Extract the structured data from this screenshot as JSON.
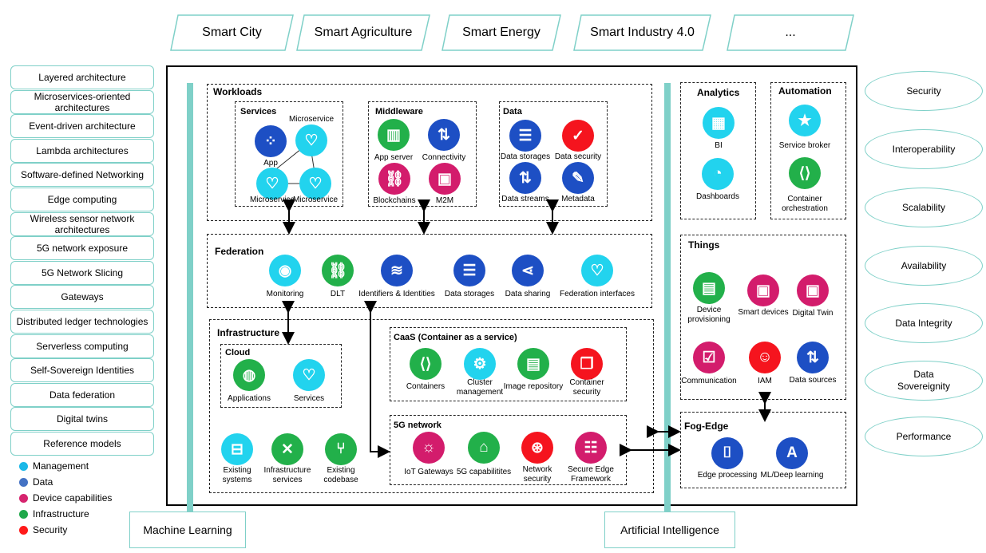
{
  "domains": [
    "Smart City",
    "Smart Agriculture",
    "Smart Energy",
    "Smart Industry 4.0",
    "..."
  ],
  "left_concepts": [
    "Layered architecture",
    "Microservices-oriented architectures",
    "Event-driven architecture",
    "Lambda architectures",
    "Software-defined Networking",
    "Edge computing",
    "Wireless sensor network architectures",
    "5G network exposure",
    "5G Network Slicing",
    "Gateways",
    "Distributed ledger technologies",
    "Serverless computing",
    "Self-Sovereign Identities",
    "Data federation",
    "Digital twins",
    "Reference models"
  ],
  "legend": [
    {
      "label": "Management",
      "color": "#1ab8e8"
    },
    {
      "label": "Data",
      "color": "#4472c4"
    },
    {
      "label": "Device capabilities",
      "color": "#d6246e"
    },
    {
      "label": "Infrastructure",
      "color": "#1fa84a"
    },
    {
      "label": "Security",
      "color": "#ff1a1a"
    }
  ],
  "colors": {
    "management": "#22d3ee",
    "data": "#1d4fc4",
    "device": "#d31c6c",
    "infrastructure": "#22b04a",
    "security": "#f5141e",
    "teal": "#7fd0c8"
  },
  "workloads": {
    "title": "Workloads",
    "services": {
      "title": "Services",
      "items": [
        {
          "label": "App",
          "icon": "apps-grid-icon",
          "category": "data"
        },
        {
          "label": "Microservice",
          "icon": "heart-link-icon",
          "category": "management"
        },
        {
          "label": "Microservice",
          "icon": "heart-link-icon",
          "category": "management"
        },
        {
          "label": "Microservice",
          "icon": "heart-link-icon",
          "category": "management"
        }
      ]
    },
    "middleware": {
      "title": "Middleware",
      "items": [
        {
          "label": "App server",
          "icon": "server-icon",
          "category": "infrastructure"
        },
        {
          "label": "Connectivity",
          "icon": "up-down-arrows-icon",
          "category": "data"
        },
        {
          "label": "Blockchains",
          "icon": "chain-link-icon",
          "category": "device"
        },
        {
          "label": "M2M",
          "icon": "chip-icon",
          "category": "device"
        }
      ]
    },
    "data": {
      "title": "Data",
      "items": [
        {
          "label": "Data storages",
          "icon": "database-icon",
          "category": "data"
        },
        {
          "label": "Data security",
          "icon": "shield-check-icon",
          "category": "security"
        },
        {
          "label": "Data streams",
          "icon": "up-down-arrows-icon",
          "category": "data"
        },
        {
          "label": "Metadata",
          "icon": "edit-document-icon",
          "category": "data"
        }
      ]
    }
  },
  "federation": {
    "title": "Federation",
    "items": [
      {
        "label": "Monitoring",
        "icon": "eye-icon",
        "category": "management"
      },
      {
        "label": "DLT",
        "icon": "chain-link-icon",
        "category": "infrastructure"
      },
      {
        "label": "Identifiers & Identities",
        "icon": "layers-icon",
        "category": "data"
      },
      {
        "label": "Data storages",
        "icon": "database-icon",
        "category": "data"
      },
      {
        "label": "Data sharing",
        "icon": "share-icon",
        "category": "data"
      },
      {
        "label": "Federation interfaces",
        "icon": "heart-link-icon",
        "category": "management"
      }
    ]
  },
  "infrastructure": {
    "title": "Infrastructure",
    "cloud": {
      "title": "Cloud",
      "items": [
        {
          "label": "Applications",
          "icon": "globe-icon",
          "category": "infrastructure"
        },
        {
          "label": "Services",
          "icon": "heart-link-icon",
          "category": "management"
        }
      ]
    },
    "items": [
      {
        "label": "Existing systems",
        "icon": "briefcase-icon",
        "category": "management"
      },
      {
        "label": "Infrastructure services",
        "icon": "tools-icon",
        "category": "infrastructure"
      },
      {
        "label": "Existing codebase",
        "icon": "branch-icon",
        "category": "infrastructure"
      }
    ],
    "caas": {
      "title": "CaaS (Container as a service)",
      "items": [
        {
          "label": "Containers",
          "icon": "code-icon",
          "category": "infrastructure"
        },
        {
          "label": "Cluster management",
          "icon": "gear-icon",
          "category": "management"
        },
        {
          "label": "Image repository",
          "icon": "layout-window-icon",
          "category": "infrastructure"
        },
        {
          "label": "Container security",
          "icon": "copy-check-icon",
          "category": "security"
        }
      ]
    },
    "fiveg": {
      "title": "5G network",
      "items": [
        {
          "label": "IoT Gateways",
          "icon": "lightbulb-icon",
          "category": "device"
        },
        {
          "label": "5G capabilitites",
          "icon": "router-icon",
          "category": "infrastructure"
        },
        {
          "label": "Network security",
          "icon": "antenna-icon",
          "category": "security"
        },
        {
          "label": "Secure Edge Framework",
          "icon": "settings-list-icon",
          "category": "device"
        }
      ]
    }
  },
  "analytics": {
    "title": "Analytics",
    "items": [
      {
        "label": "BI",
        "icon": "bar-chart-icon",
        "category": "management"
      },
      {
        "label": "Dashboards",
        "icon": "gauge-icon",
        "category": "management"
      }
    ]
  },
  "automation": {
    "title": "Automation",
    "items": [
      {
        "label": "Service broker",
        "icon": "star-icon",
        "category": "management"
      },
      {
        "label": "Container orchestration",
        "icon": "code-icon",
        "category": "infrastructure"
      }
    ]
  },
  "things": {
    "title": "Things",
    "items": [
      {
        "label": "Device provisioning",
        "icon": "layout-window-icon",
        "category": "infrastructure"
      },
      {
        "label": "Smart devices",
        "icon": "chip-icon",
        "category": "device"
      },
      {
        "label": "Digital Twin",
        "icon": "chip-icon",
        "category": "device"
      },
      {
        "label": "Communication",
        "icon": "message-check-icon",
        "category": "device"
      },
      {
        "label": "IAM",
        "icon": "user-badge-icon",
        "category": "security"
      },
      {
        "label": "Data sources",
        "icon": "up-down-arrows-icon",
        "category": "data"
      }
    ]
  },
  "fogedge": {
    "title": "Fog-Edge",
    "items": [
      {
        "label": "Edge processing",
        "icon": "scan-icon",
        "category": "data"
      },
      {
        "label": "ML/Deep learning",
        "icon": "text-scan-icon",
        "category": "data"
      }
    ]
  },
  "qualities": [
    "Security",
    "Interoperability",
    "Scalability",
    "Availability",
    "Data Integrity",
    "Data Sovereignity",
    "Performance"
  ],
  "bottom": {
    "machine_learning": "Machine Learning",
    "artificial_intelligence": "Artificial Intelligence"
  },
  "glyphs": {
    "apps-grid-icon": "⁘",
    "heart-link-icon": "♡",
    "server-icon": "▥",
    "up-down-arrows-icon": "⇅",
    "chain-link-icon": "⛓",
    "chip-icon": "▣",
    "database-icon": "☰",
    "shield-check-icon": "✓",
    "edit-document-icon": "✎",
    "eye-icon": "◉",
    "layers-icon": "≋",
    "share-icon": "⋖",
    "globe-icon": "◍",
    "briefcase-icon": "⊟",
    "tools-icon": "✕",
    "branch-icon": "⑂",
    "code-icon": "⟨⟩",
    "gear-icon": "⚙",
    "layout-window-icon": "▤",
    "copy-check-icon": "❐",
    "lightbulb-icon": "☼",
    "router-icon": "⌂",
    "antenna-icon": "⊛",
    "settings-list-icon": "☷",
    "bar-chart-icon": "▦",
    "gauge-icon": "◔",
    "star-icon": "★",
    "message-check-icon": "☑",
    "user-badge-icon": "☺",
    "scan-icon": "⌷",
    "text-scan-icon": "A"
  }
}
